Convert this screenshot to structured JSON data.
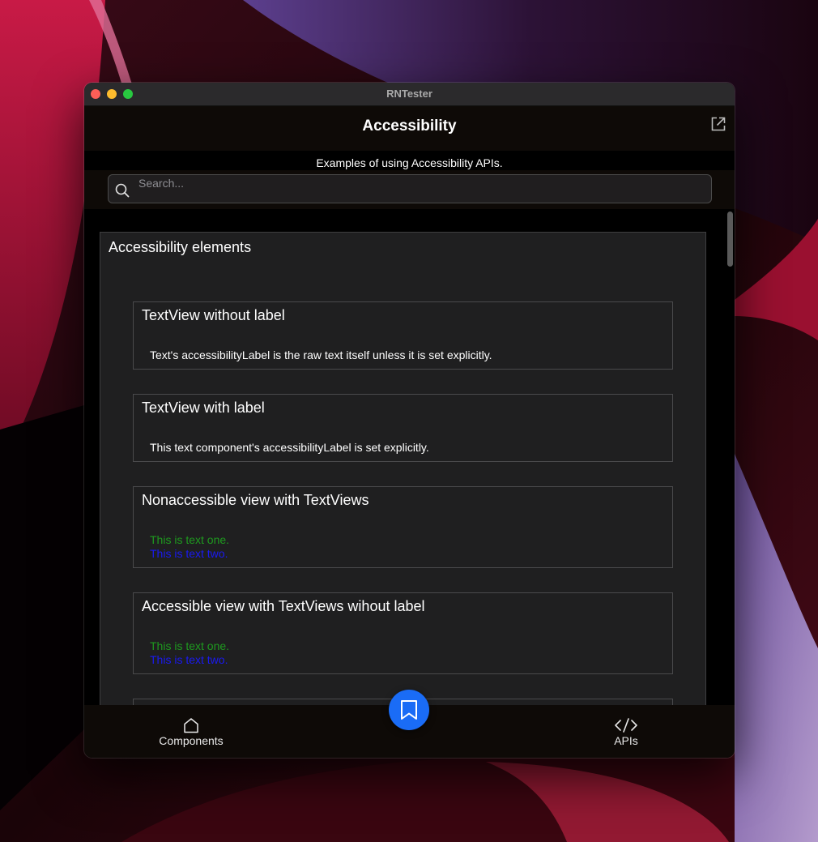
{
  "window": {
    "title": "RNTester"
  },
  "header": {
    "title": "Accessibility",
    "description": "Examples of using Accessibility APIs."
  },
  "search": {
    "placeholder": "Search..."
  },
  "module": {
    "title": "Accessibility elements",
    "examples": [
      {
        "title": "TextView without label",
        "texts": [
          "Text's accessibilityLabel is the raw text itself unless it is set explicitly."
        ]
      },
      {
        "title": "TextView with label",
        "texts": [
          "This text component's accessibilityLabel is set explicitly."
        ]
      },
      {
        "title": "Nonaccessible view with TextViews",
        "texts": [
          "This is text one.",
          "This is text two."
        ]
      },
      {
        "title": "Accessible view with TextViews wihout label",
        "texts": [
          "This is text one.",
          "This is text two."
        ]
      }
    ]
  },
  "tabbar": {
    "components_label": "Components",
    "apis_label": "APIs"
  },
  "colors": {
    "accent": "#1a6cf6",
    "text_green": "#1f9a1f",
    "text_blue": "#1a1af2"
  },
  "icons": {
    "open_external": "open-external-icon",
    "search": "search-icon",
    "components": "home-icon",
    "bookmark": "bookmark-icon",
    "apis": "code-icon"
  }
}
